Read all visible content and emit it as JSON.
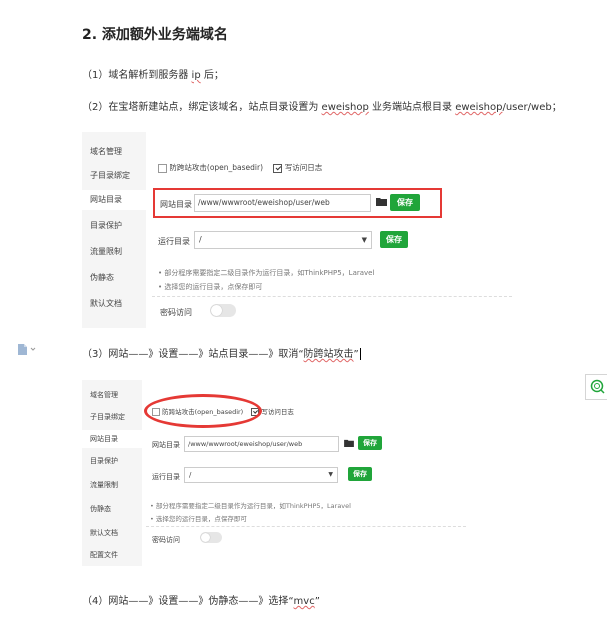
{
  "heading": "2. 添加额外业务端域名",
  "step1": {
    "pre": "（1）域名解析到服务器 ",
    "ip": "ip",
    "post": " 后；"
  },
  "step2": {
    "pre": "（2）在宝塔新建站点，绑定该域名，站点目录设置为 ",
    "w1": "eweishop",
    "mid": " 业务端站点根目录 ",
    "w2": "eweishop",
    "post": "/user/web；"
  },
  "step3": {
    "text": "（3）网站——》设置——》站点目录——》取消“",
    "w": "防跨站攻击",
    "end": "”"
  },
  "step4": {
    "text": "（4）网站——》设置——》伪静态——》选择“",
    "w": "mvc",
    "end": "”"
  },
  "fig1": {
    "sidebar": [
      "域名管理",
      "子目录绑定",
      "网站目录",
      "目录保护",
      "流量限制",
      "伪静态",
      "默认文档"
    ],
    "active_index": 2,
    "cb1": "防跨站攻击(open_basedir)",
    "cb2": "写访问日志",
    "dir_label": "网站目录",
    "dir_value": "/www/wwwroot/eweishop/user/web",
    "save": "保存",
    "run_label": "运行目录",
    "run_value": "/",
    "note1": "部分程序需要指定二级目录作为运行目录，如ThinkPHP5，Laravel",
    "note2": "选择您的运行目录，点保存即可",
    "secret_label": "密码访问"
  },
  "fig2": {
    "sidebar": [
      "域名管理",
      "子目录绑定",
      "网站目录",
      "目录保护",
      "流量限制",
      "伪静态",
      "默认文档",
      "配置文件"
    ],
    "active_index": 2,
    "cb1": "防跨站攻击(open_basedir)",
    "cb2": "写访问日志",
    "dir_label": "网站目录",
    "dir_value": "/www/wwwroot/eweishop/user/web",
    "save": "保存",
    "run_label": "运行目录",
    "run_value": "/",
    "note1": "部分程序需要指定二级目录作为运行目录，如ThinkPHP5，Laravel",
    "note2": "选择您的运行目录，点保存即可",
    "secret_label": "密码访问"
  },
  "colors": {
    "accent": "#20a53a",
    "highlight": "#e53935"
  },
  "icons": {
    "doc": "document-icon",
    "side": "search-circle-icon",
    "folder": "folder-icon"
  }
}
